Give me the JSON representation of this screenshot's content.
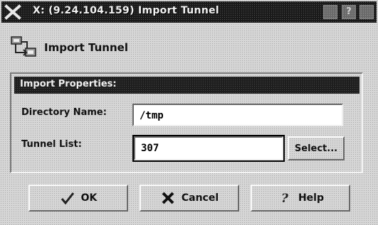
{
  "window": {
    "title": "X: (9.24.104.159) Import Tunnel",
    "maximize_glyph": "?",
    "minimize_glyph": "□"
  },
  "header": {
    "title": "Import Tunnel",
    "icon": "tunnel-import-icon"
  },
  "properties": {
    "group_title": "Import Properties:",
    "directory_label": "Directory Name:",
    "directory_value": "/tmp",
    "tunnel_list_label": "Tunnel List:",
    "tunnel_list_value": "307",
    "select_label": "Select..."
  },
  "buttons": {
    "ok_label": "OK",
    "cancel_label": "Cancel",
    "help_label": "Help"
  }
}
